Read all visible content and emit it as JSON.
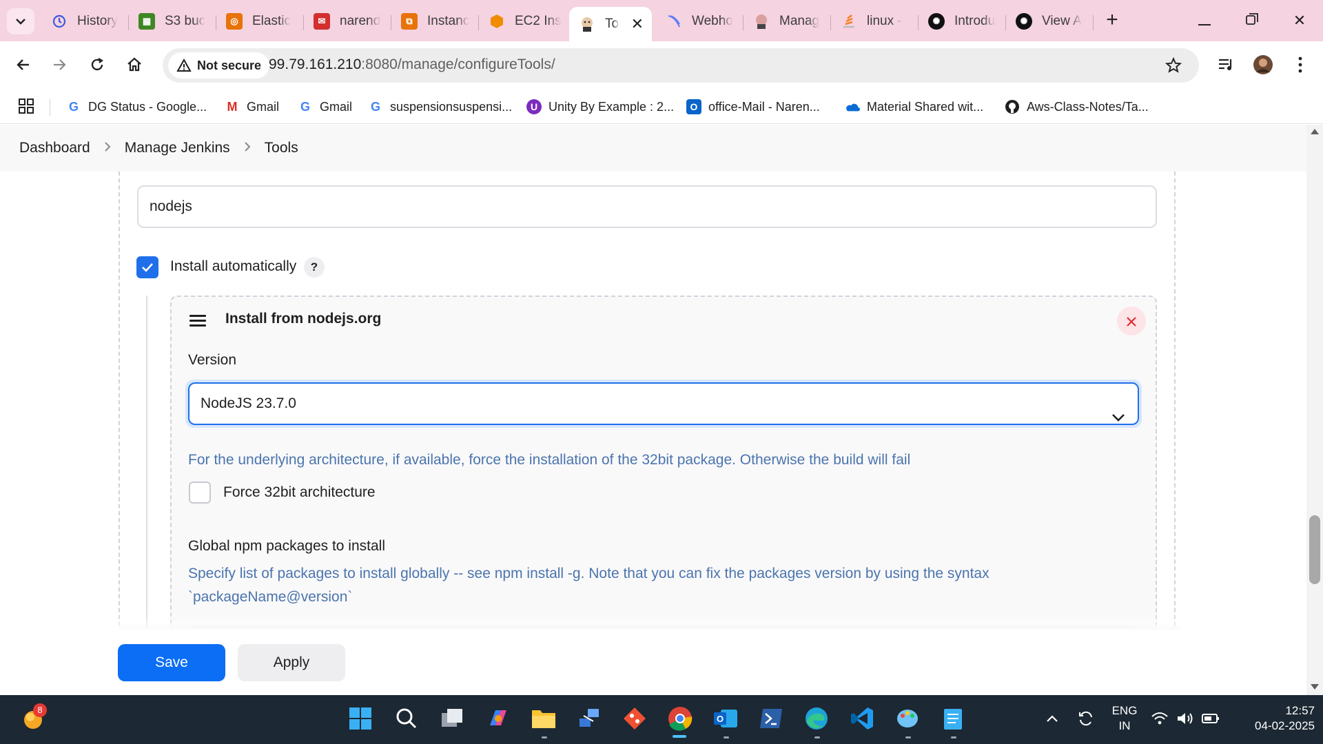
{
  "browser": {
    "tabs": [
      {
        "label": "History",
        "icon": "history-icon",
        "color": "#3b5bdb"
      },
      {
        "label": "S3 buc",
        "icon": "s3-icon",
        "color": "#3f8624"
      },
      {
        "label": "Elastic",
        "icon": "elastic-icon",
        "color": "#e8730a"
      },
      {
        "label": "narend",
        "icon": "mail-icon",
        "color": "#d32f2f"
      },
      {
        "label": "Instanc",
        "icon": "instances-icon",
        "color": "#e8730a"
      },
      {
        "label": "EC2 Ins",
        "icon": "ec2-icon",
        "color": "#f08c00"
      },
      {
        "label": "To",
        "icon": "jenkins-icon",
        "color": "#c9a27e",
        "active": true
      },
      {
        "label": "Webho",
        "icon": "webhook-icon",
        "color": "#5c7cfa"
      },
      {
        "label": "Manag",
        "icon": "jenkins-icon",
        "color": "#a55"
      },
      {
        "label": "linux -",
        "icon": "stackoverflow-icon",
        "color": "#f48024"
      },
      {
        "label": "Introdu",
        "icon": "chatgpt-icon",
        "color": "#111"
      },
      {
        "label": "View A",
        "icon": "chatgpt-icon",
        "color": "#111"
      }
    ],
    "security_label": "Not secure",
    "url_host": "99.79.161.210",
    "url_rest": ":8080/manage/configureTools/",
    "bookmarks": [
      {
        "label": "DG Status - Google...",
        "icon": "google-icon"
      },
      {
        "label": "Gmail",
        "icon": "gmail-icon"
      },
      {
        "label": "Gmail",
        "icon": "google-icon"
      },
      {
        "label": "suspensionsuspensi...",
        "icon": "google-icon"
      },
      {
        "label": "Unity By Example : 2...",
        "icon": "udemy-icon"
      },
      {
        "label": "office-Mail - Naren...",
        "icon": "outlook-icon"
      },
      {
        "label": "Material Shared wit...",
        "icon": "onedrive-icon"
      },
      {
        "label": "Aws-Class-Notes/Ta...",
        "icon": "github-icon"
      }
    ]
  },
  "breadcrumb": [
    "Dashboard",
    "Manage Jenkins",
    "Tools"
  ],
  "form": {
    "name_value": "nodejs",
    "install_auto_label": "Install automatically",
    "help_label": "?",
    "installer_title": "Install from nodejs.org",
    "version_label": "Version",
    "version_value": "NodeJS 23.7.0",
    "force32_desc": "For the underlying architecture, if available, force the installation of the 32bit package. Otherwise the build will fail",
    "force32_label": "Force 32bit architecture",
    "npm_label": "Global npm packages to install",
    "npm_desc_1": "Specify list of packages to install globally -- see npm install -g. Note that you can fix the packages version by using the syntax",
    "npm_desc_2": "`packageName@version`"
  },
  "actions": {
    "save": "Save",
    "apply": "Apply"
  },
  "taskbar": {
    "notification_count": "8",
    "lang_1": "ENG",
    "lang_2": "IN",
    "time": "12:57",
    "date": "04-02-2025"
  },
  "colors": {
    "accent": "#1f6feb",
    "save": "#0b6ef5",
    "desc_text": "#4b74ad",
    "tabstrip": "#f6d3e1"
  }
}
